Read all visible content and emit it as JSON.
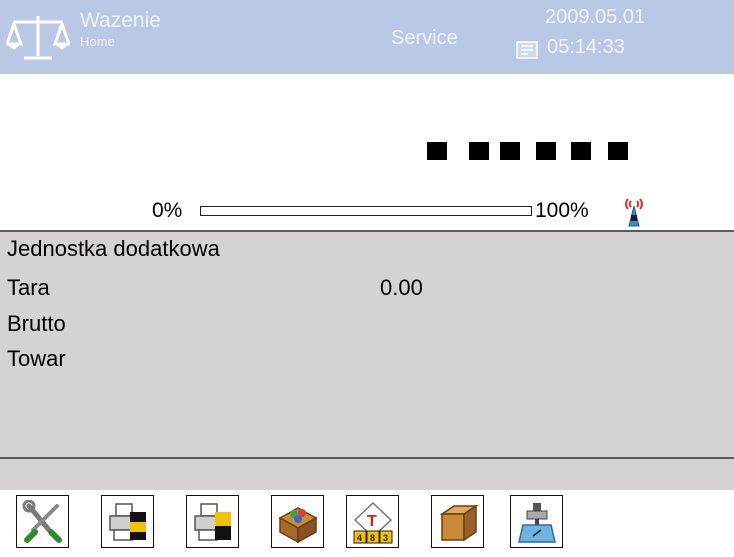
{
  "header": {
    "title": "Wazenie",
    "subtitle": "Home",
    "user": "Service",
    "date": "2009.05.01",
    "time": "05:14:33",
    "logo_icon": "scale-balance-icon",
    "clock_icon": "clock-icon"
  },
  "display": {
    "weight": "------",
    "progress_min_label": "0%",
    "progress_max_label": "100%",
    "progress_fraction": 0.0,
    "signal_icon": "wireless-signal-icon"
  },
  "info": {
    "rows": [
      {
        "label": "Jednostka dodatkowa",
        "value": ""
      },
      {
        "label": "Tara",
        "value": "0.00"
      },
      {
        "label": "Brutto",
        "value": ""
      },
      {
        "label": "Towar",
        "value": ""
      }
    ]
  },
  "toolbar": {
    "buttons": [
      {
        "icon": "settings-tools-icon"
      },
      {
        "icon": "print-header-icon"
      },
      {
        "icon": "print-footer-icon"
      },
      {
        "icon": "product-database-icon"
      },
      {
        "icon": "tare-icon"
      },
      {
        "icon": "packaging-icon"
      },
      {
        "icon": "weighing-pan-icon"
      }
    ]
  },
  "colors": {
    "header_bg": "#b9c9e5",
    "info_bg": "#d4d2d2",
    "accent_yellow": "#f2c200"
  }
}
